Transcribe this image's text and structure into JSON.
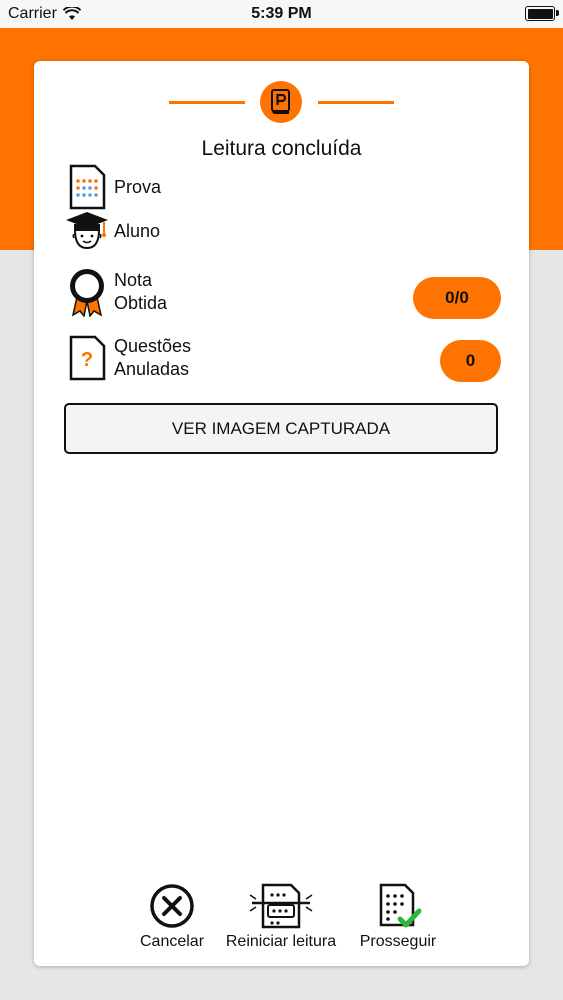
{
  "status_bar": {
    "carrier": "Carrier",
    "time": "5:39 PM"
  },
  "header": {
    "title": "Leitura concluída"
  },
  "rows": {
    "prova": {
      "label": "Prova",
      "icon": "exam-sheet-icon"
    },
    "aluno": {
      "label": "Aluno",
      "icon": "student-graduation-cap-icon"
    },
    "nota": {
      "label_line1": "Nota",
      "label_line2": "Obtida",
      "value": "0/0",
      "icon": "award-ribbon-icon"
    },
    "questoes": {
      "label_line1": "Questões",
      "label_line2": "Anuladas",
      "value": "0",
      "icon": "question-document-icon"
    }
  },
  "capture_button": {
    "label": "VER IMAGEM CAPTURADA"
  },
  "actions": {
    "cancel": {
      "label": "Cancelar",
      "icon": "close-circle-icon"
    },
    "restart": {
      "label": "Reiniciar leitura",
      "icon": "scanner-icon"
    },
    "proceed": {
      "label": "Prosseguir",
      "icon": "answer-sheet-check-icon"
    }
  },
  "colors": {
    "accent": "#ff7300",
    "background": "#e6e6e6",
    "card": "#ffffff",
    "success": "#2db83d"
  }
}
